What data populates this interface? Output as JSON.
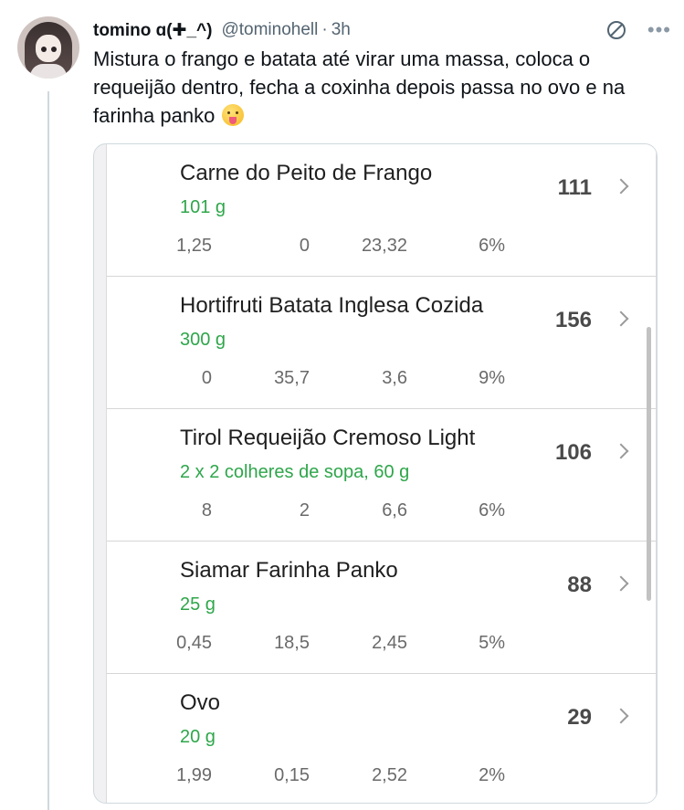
{
  "tweet": {
    "display_name": "tomino ɑ(✚_^)",
    "handle": "@tominohell",
    "separator": "·",
    "time": "3h",
    "text": "Mistura o frango e batata até virar uma massa, coloca o requeijão dentro, fecha a coxinha depois passa no ovo e na farinha panko"
  },
  "icons": {
    "no_entry": "no-entry-icon",
    "more": "more-icon",
    "emoji": "tongue-out-emoji",
    "chevron": "chevron-right-icon"
  },
  "more_label": "•••",
  "food_list": [
    {
      "name": "Carne do Peito de Frango",
      "portion": "101 g",
      "kcal": "111",
      "macros": [
        "1,25",
        "0",
        "23,32",
        "6%"
      ]
    },
    {
      "name": "Hortifruti Batata Inglesa Cozida",
      "portion": "300 g",
      "kcal": "156",
      "macros": [
        "0",
        "35,7",
        "3,6",
        "9%"
      ]
    },
    {
      "name": "Tirol Requeijão Cremoso Light",
      "portion": "2 x 2 colheres de sopa, 60 g",
      "kcal": "106",
      "macros": [
        "8",
        "2",
        "6,6",
        "6%"
      ]
    },
    {
      "name": "Siamar Farinha Panko",
      "portion": "25 g",
      "kcal": "88",
      "macros": [
        "0,45",
        "18,5",
        "2,45",
        "5%"
      ]
    },
    {
      "name": "Ovo",
      "portion": "20 g",
      "kcal": "29",
      "macros": [
        "1,99",
        "0,15",
        "2,52",
        "2%"
      ]
    }
  ],
  "colors": {
    "portion_green": "#2ea64a",
    "secondary_text": "#536471"
  }
}
